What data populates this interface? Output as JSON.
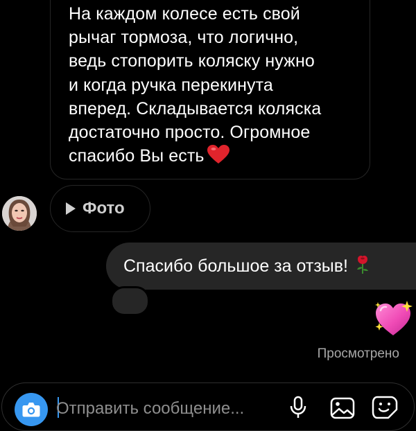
{
  "thread": {
    "incoming_message": "На каждом колесе есть свой\nрычаг тормоза, что логично,\nведь стопорить коляску нужно\nи когда ручка перекинута\nвперед. Складывается коляска\nдостаточно просто. Огромное\nспасибо Вы есть",
    "incoming_emoji": "red-heart",
    "attachment_label": "Фото",
    "outgoing_message": "Спасибо большое за отзыв!",
    "outgoing_emoji": "rose",
    "sent_sticker": "sparkling-heart",
    "status": "Просмотрено"
  },
  "composer": {
    "placeholder": "Отправить сообщение..."
  },
  "colors": {
    "background": "#000000",
    "outgoing_bubble": "#262626",
    "accent": "#3797f0",
    "seen_text": "#a8a8a8"
  }
}
